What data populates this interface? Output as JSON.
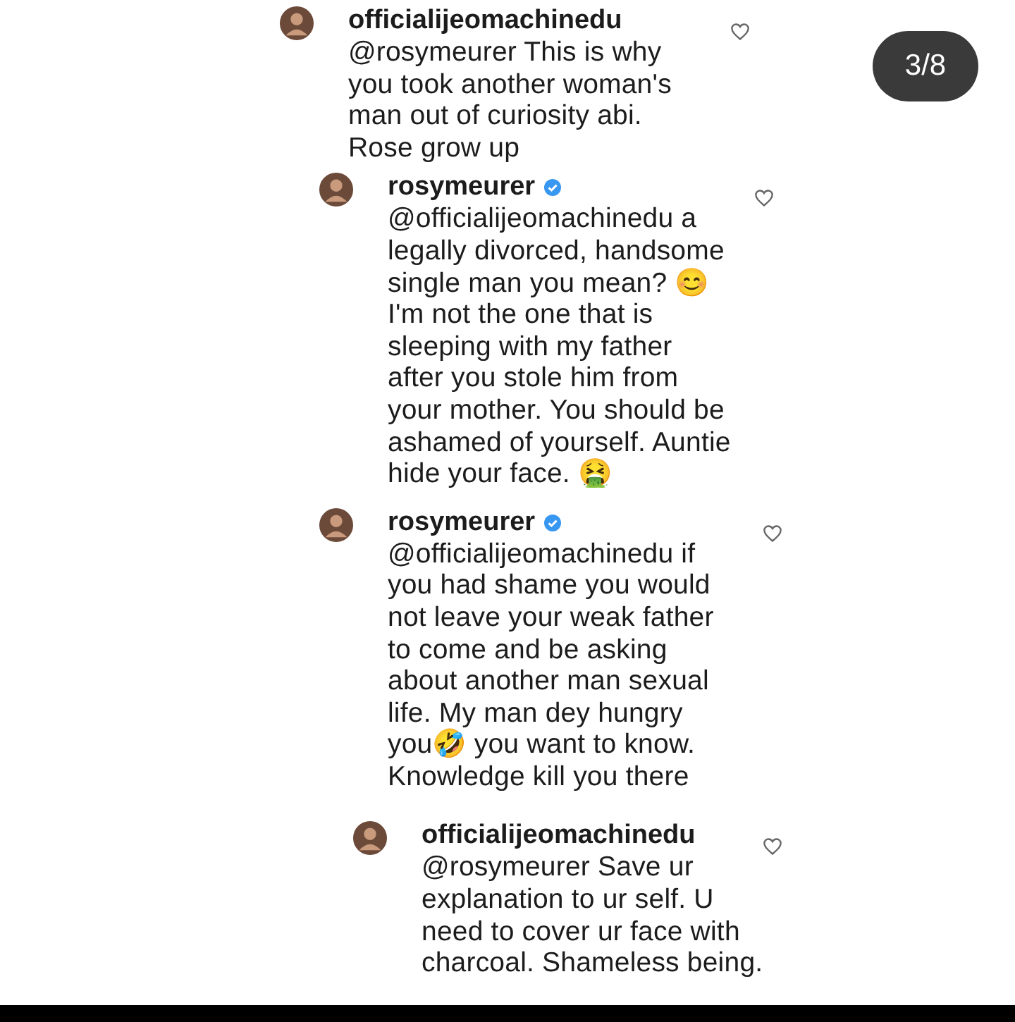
{
  "page_indicator": "3/8",
  "comments": [
    {
      "username": "officialijeomachinedu",
      "verified": false,
      "lines": [
        "@rosymeurer This is why",
        "you took another woman's",
        "man out of curiosity abi.",
        "Rose grow up"
      ]
    },
    {
      "username": "rosymeurer",
      "verified": true,
      "lines": [
        "@officialijeomachinedu a",
        "legally divorced, handsome",
        "single man you mean? 😊",
        "I'm not the one that is",
        "sleeping with my father",
        "after you stole him from",
        "your mother. You should be",
        "ashamed of yourself. Auntie",
        "hide your face. 🤮"
      ]
    },
    {
      "username": "rosymeurer",
      "verified": true,
      "lines": [
        "@officialijeomachinedu if",
        "you had shame you would",
        "not leave your weak father",
        "to come and be asking",
        "about another man sexual",
        "life. My man dey hungry",
        "you🤣 you want to know.",
        "Knowledge kill you there"
      ]
    },
    {
      "username": "officialijeomachinedu",
      "verified": false,
      "lines": [
        "@rosymeurer Save ur",
        "explanation to ur self. U",
        "need to cover ur face with",
        "charcoal. Shameless being."
      ]
    }
  ]
}
